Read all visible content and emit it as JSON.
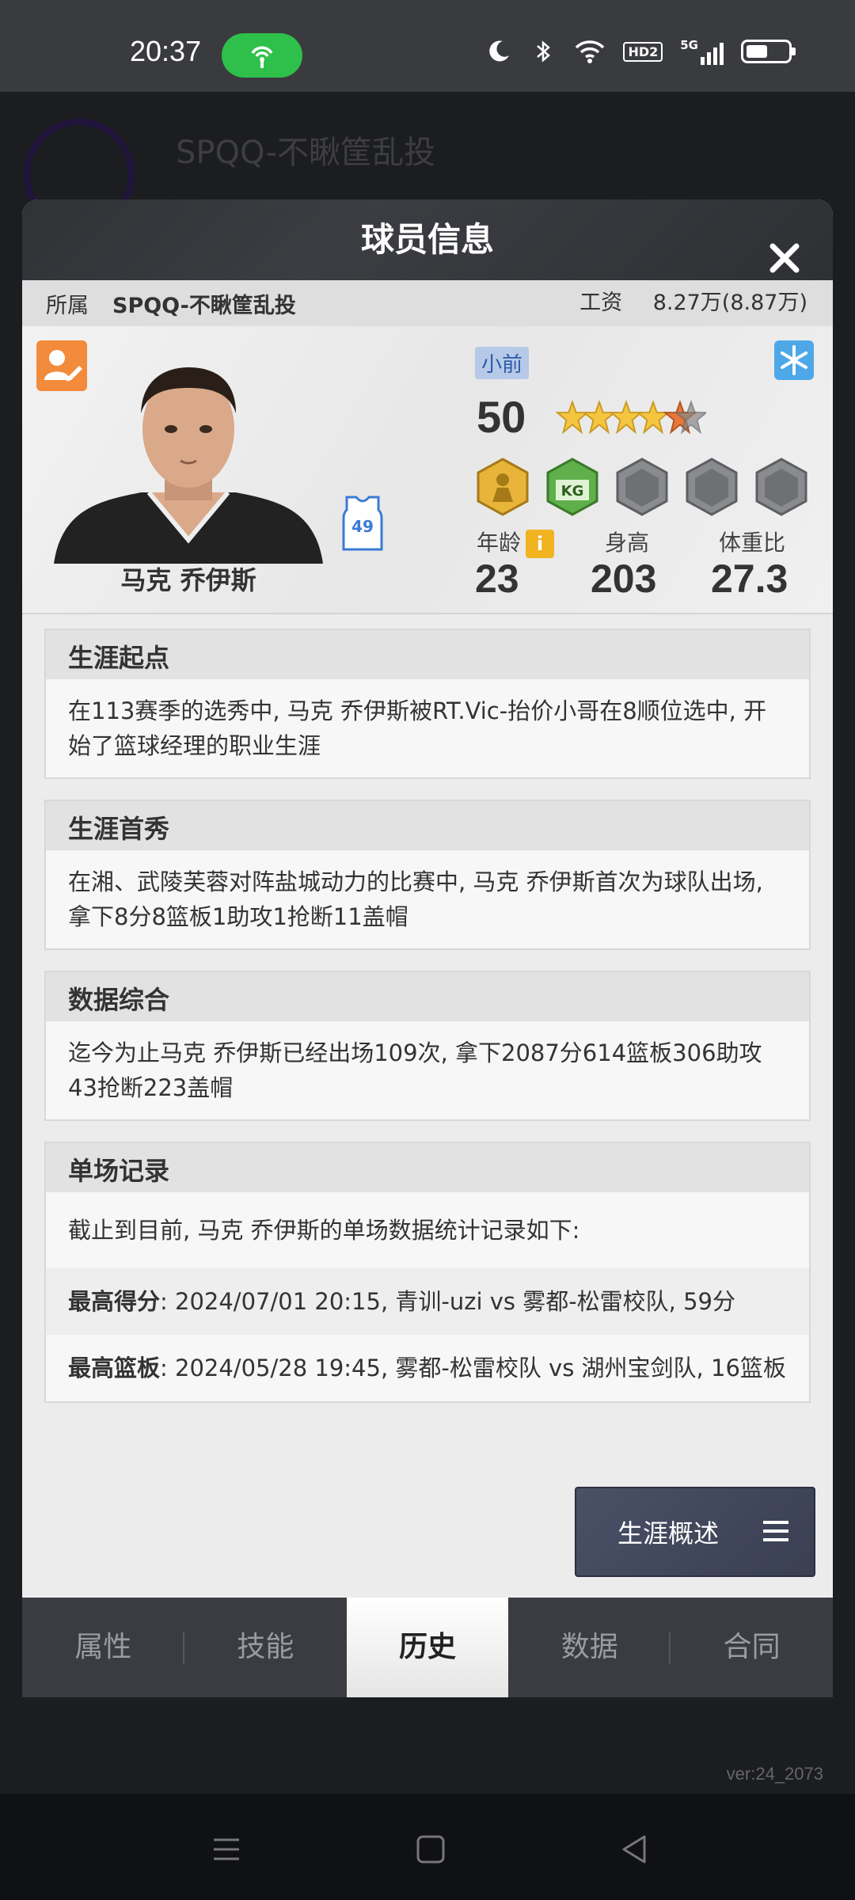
{
  "status_bar": {
    "time": "20:37",
    "icons": [
      "hotspot-icon",
      "moon-icon",
      "bluetooth-icon",
      "wifi-icon",
      "hd2-icon",
      "5g-signal-icon",
      "battery-icon"
    ],
    "hd_label": "HD2",
    "net_label": "5G"
  },
  "background": {
    "title": "SPQQ-不瞅筐乱投",
    "version": "ver:24_2073"
  },
  "modal": {
    "title": "球员信息",
    "team_label": "所属",
    "team_name": "SPQQ-不瞅筐乱投",
    "salary_label": "工资",
    "salary_value": "8.27万(8.87万)"
  },
  "player": {
    "name": "马克 乔伊斯",
    "jersey_number": "49",
    "position": "小前",
    "rating": "50",
    "stars": 4.5,
    "age_label": "年龄",
    "age": "23",
    "height_label": "身高",
    "height": "203",
    "weight_ratio_label": "体重比",
    "weight_ratio": "27.3",
    "info_icon": "i",
    "badges": [
      "gold-player-badge",
      "kg-green-badge",
      "empty-badge",
      "empty-badge",
      "empty-badge"
    ]
  },
  "sections": [
    {
      "title": "生涯起点",
      "body": "在113赛季的选秀中, 马克 乔伊斯被RT.Vic-抬价小哥在8顺位选中, 开始了篮球经理的职业生涯"
    },
    {
      "title": "生涯首秀",
      "body": "在湘、武陵芙蓉对阵盐城动力的比赛中, 马克 乔伊斯首次为球队出场, 拿下8分8篮板1助攻1抢断11盖帽"
    },
    {
      "title": "数据综合",
      "body": "迄今为止马克 乔伊斯已经出场109次, 拿下2087分614篮板306助攻43抢断223盖帽"
    }
  ],
  "records": {
    "title": "单场记录",
    "intro": "截止到目前, 马克 乔伊斯的单场数据统计记录如下:",
    "items": [
      {
        "label": "最高得分",
        "text": ": 2024/07/01 20:15, 青训-uzi vs 雾都-松雷校队, 59分"
      },
      {
        "label": "最高篮板",
        "text": ": 2024/05/28 19:45, 雾都-松雷校队 vs 湖州宝剑队, 16篮板"
      }
    ]
  },
  "career_button": "生涯概述",
  "tabs": [
    "属性",
    "技能",
    "历史",
    "数据",
    "合同"
  ],
  "active_tab": "历史",
  "colors": {
    "accent_orange": "#f28b3c",
    "hotspot_green": "#2ec04a",
    "info_yellow": "#f2b321"
  }
}
